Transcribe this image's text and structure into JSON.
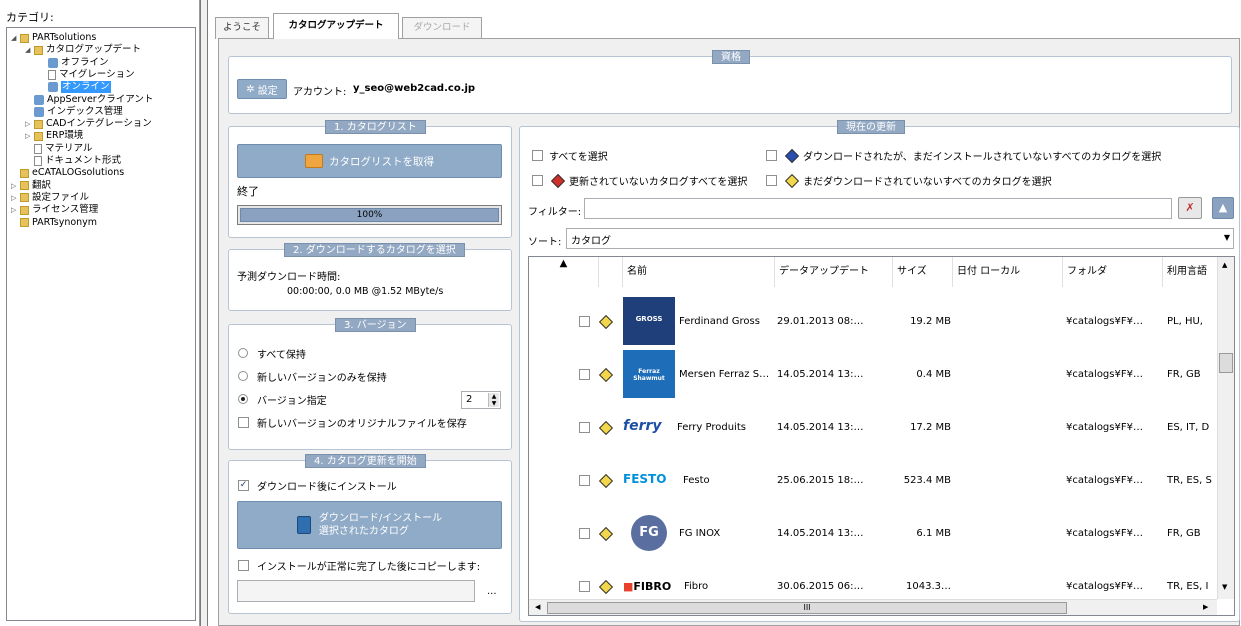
{
  "sidebar": {
    "title": "カテゴリ:",
    "tree": [
      {
        "label": "PARTsolutions",
        "depth": 0,
        "icon": "folder-icon",
        "exp": "◢"
      },
      {
        "label": "カタログアップデート",
        "depth": 1,
        "icon": "folder-icon",
        "exp": "◢"
      },
      {
        "label": "オフライン",
        "depth": 2,
        "icon": "gear-icon",
        "exp": ""
      },
      {
        "label": "マイグレーション",
        "depth": 2,
        "icon": "document-icon",
        "exp": ""
      },
      {
        "label": "オンライン",
        "depth": 2,
        "icon": "gear-icon",
        "exp": "",
        "selected": true
      },
      {
        "label": "AppServerクライアント",
        "depth": 1,
        "icon": "gear-icon",
        "exp": ""
      },
      {
        "label": "インデックス管理",
        "depth": 1,
        "icon": "gear-icon",
        "exp": ""
      },
      {
        "label": "CADインテグレーション",
        "depth": 1,
        "icon": "folder-icon",
        "exp": "▷"
      },
      {
        "label": "ERP環境",
        "depth": 1,
        "icon": "folder-icon",
        "exp": "▷"
      },
      {
        "label": "マテリアル",
        "depth": 1,
        "icon": "document-icon",
        "exp": ""
      },
      {
        "label": "ドキュメント形式",
        "depth": 1,
        "icon": "document-icon",
        "exp": ""
      },
      {
        "label": "eCATALOGsolutions",
        "depth": 0,
        "icon": "folder-icon",
        "exp": ""
      },
      {
        "label": "翻訳",
        "depth": 0,
        "icon": "folder-icon",
        "exp": "▷"
      },
      {
        "label": "設定ファイル",
        "depth": 0,
        "icon": "folder-icon",
        "exp": "▷"
      },
      {
        "label": "ライセンス管理",
        "depth": 0,
        "icon": "folder-icon",
        "exp": "▷"
      },
      {
        "label": "PARTsynonym",
        "depth": 0,
        "icon": "folder-icon",
        "exp": ""
      }
    ]
  },
  "tabs": [
    {
      "label": "ようこそ"
    },
    {
      "label": "カタログアップデート"
    },
    {
      "label": "ダウンロード"
    }
  ],
  "qualification": {
    "title": "資格",
    "settings_label": "設定",
    "account_label": "アカウント:",
    "account_value": "y_seo@web2cad.co.jp"
  },
  "catalog_list": {
    "title": "1. カタログリスト",
    "get_button": "カタログリストを取得",
    "status": "終了",
    "progress": 1.0,
    "progress_text": "100%"
  },
  "select_download": {
    "title": "2. ダウンロードするカタログを選択",
    "est_label": "予測ダウンロード時間:",
    "est_value": "00:00:00, 0.0 MB  @1.52 MByte/s"
  },
  "version": {
    "title": "3. バージョン",
    "opt_all": "すべて保持",
    "opt_new": "新しいバージョンのみを保持",
    "opt_specify": "バージョン指定",
    "specify_value": "2",
    "save_original": "新しいバージョンのオリジナルファイルを保存"
  },
  "start": {
    "title": "4. カタログ更新を開始",
    "install_after": "ダウンロード後にインストール",
    "button_line1": "ダウンロード/インストール",
    "button_line2": "選択されたカタログ",
    "copy_after": "インストールが正常に完了した後にコピーします:",
    "browse": "..."
  },
  "current": {
    "title": "現在の更新",
    "select_all": "すべてを選択",
    "select_downloaded": "ダウンロードされたが、まだインストールされていないすべてのカタログを選択",
    "select_not_updated": "更新されていないカタログすべてを選択",
    "select_not_downloaded": "まだダウンロードされていないすべてのカタログを選択",
    "filter_label": "フィルター:",
    "filter_value": "",
    "sort_label": "ソート:",
    "sort_value": "カタログ",
    "scroll_label": "III"
  },
  "columns": [
    "名前",
    "データアップデート",
    "サイズ",
    "日付 ローカル",
    "フォルダ",
    "利用言語"
  ],
  "rows": [
    {
      "name": "Ferdinand Gross",
      "date": "29.01.2013 08:…",
      "size": "19.2 MB",
      "local": "",
      "folder": "¥catalogs¥F¥…",
      "lang": "PL, HU,",
      "logo": "GROSS"
    },
    {
      "name": "Mersen Ferraz S…",
      "date": "14.05.2014 13:…",
      "size": "0.4 MB",
      "local": "",
      "folder": "¥catalogs¥F¥…",
      "lang": "FR, GB",
      "logo": "Ferraz Shawmut"
    },
    {
      "name": "Ferry Produits",
      "date": "14.05.2014 13:…",
      "size": "17.2 MB",
      "local": "",
      "folder": "¥catalogs¥F¥…",
      "lang": "ES, IT, D",
      "logo": "ferry"
    },
    {
      "name": "Festo",
      "date": "25.06.2015 18:…",
      "size": "523.4 MB",
      "local": "",
      "folder": "¥catalogs¥F¥…",
      "lang": "TR, ES, S",
      "logo": "FESTO"
    },
    {
      "name": "FG INOX",
      "date": "14.05.2014 13:…",
      "size": "6.1 MB",
      "local": "",
      "folder": "¥catalogs¥F¥…",
      "lang": "FR, GB",
      "logo": "FG"
    },
    {
      "name": "Fibro",
      "date": "30.06.2015 06:…",
      "size": "1043.3…",
      "local": "",
      "folder": "¥catalogs¥F¥…",
      "lang": "TR, ES, I",
      "logo": "FIBRO"
    }
  ],
  "colors": {
    "accent": "#93a8c2",
    "button": "#90abc7",
    "festo": "#0091dc",
    "fibro": "#e8412c",
    "red_gem": "#d0302a",
    "blue_gem": "#2a4fb0",
    "yellow_gem": "#f2d64b"
  }
}
